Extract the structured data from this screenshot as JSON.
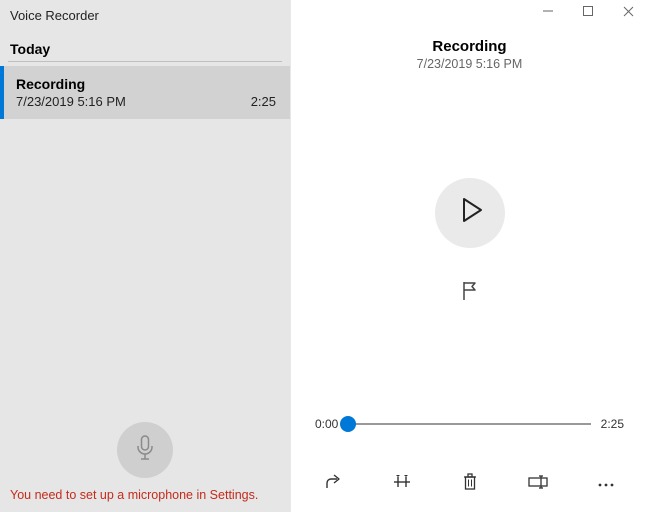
{
  "app": {
    "title": "Voice Recorder"
  },
  "sidebar": {
    "section_label": "Today",
    "items": [
      {
        "title": "Recording",
        "timestamp": "7/23/2019 5:16 PM",
        "duration": "2:25"
      }
    ],
    "warning": "You need to set up a microphone in Settings."
  },
  "main": {
    "title": "Recording",
    "timestamp": "7/23/2019 5:16 PM",
    "playback": {
      "position": "0:00",
      "duration": "2:25"
    }
  }
}
